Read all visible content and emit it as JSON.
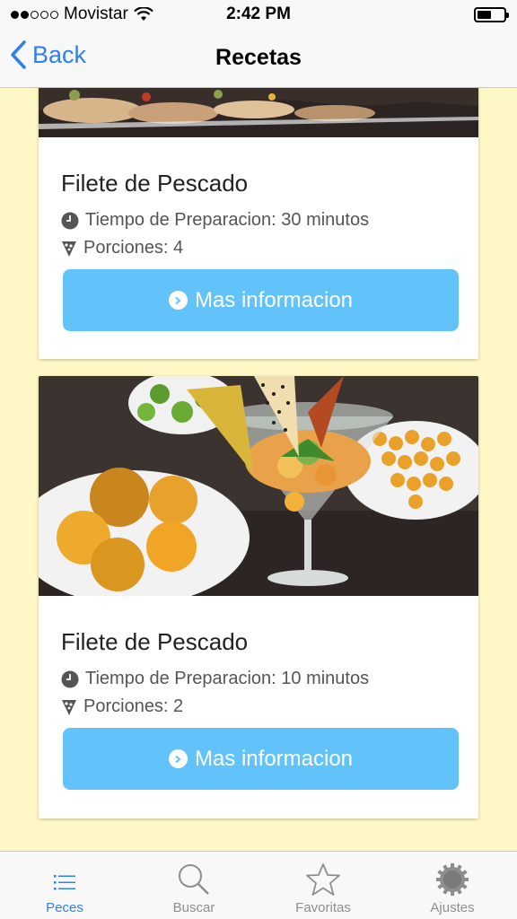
{
  "status_bar": {
    "carrier": "Movistar",
    "time": "2:42 PM"
  },
  "nav": {
    "back_label": "Back",
    "title": "Recetas"
  },
  "recipes": [
    {
      "title": "Filete de Pescado",
      "prep_time": "Tiempo de Preparacion: 30 minutos",
      "portions": "Porciones: 4",
      "button_label": "Mas informacion"
    },
    {
      "title": "Filete de Pescado",
      "prep_time": "Tiempo de Preparacion: 10 minutos",
      "portions": "Porciones: 2",
      "button_label": "Mas informacion"
    }
  ],
  "tabs": [
    {
      "label": "Peces",
      "icon": "list-icon",
      "active": true
    },
    {
      "label": "Buscar",
      "icon": "search-icon",
      "active": false
    },
    {
      "label": "Favoritas",
      "icon": "star-icon",
      "active": false
    },
    {
      "label": "Ajustes",
      "icon": "gear-icon",
      "active": false
    }
  ],
  "colors": {
    "accent": "#2f7ff0",
    "button": "#62c3fb",
    "background": "#fff8c6"
  }
}
